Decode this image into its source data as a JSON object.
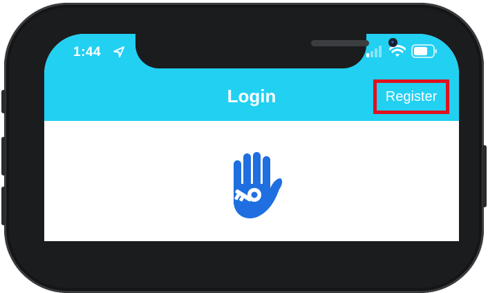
{
  "status_bar": {
    "time": "1:44",
    "icons": [
      "location-arrow-icon",
      "cellular-signal-icon",
      "wifi-icon",
      "battery-icon"
    ]
  },
  "nav_bar": {
    "title": "Login",
    "register_label": "Register",
    "background_color": "#22d0f2"
  },
  "content": {
    "logo_icon": "hand-key-icon",
    "logo_color": "#1f6fe0"
  },
  "colors": {
    "highlight_box": "#e1101e",
    "phone_frame": "#1b1c1e"
  }
}
